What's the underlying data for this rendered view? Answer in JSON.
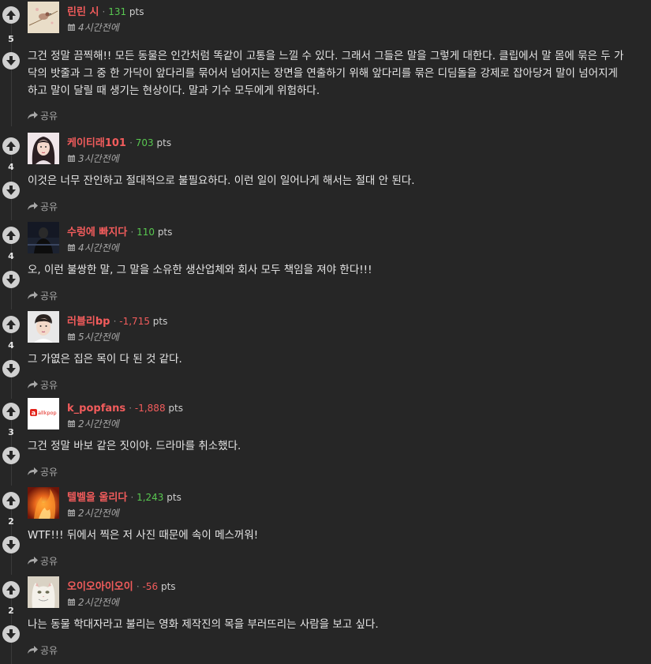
{
  "labels": {
    "share": "공유"
  },
  "comments": [
    {
      "score": "5",
      "author": "린린 시",
      "points": "131",
      "points_label": "pts",
      "points_sign": "pos",
      "time": "4시간전에",
      "avatar": "bird-avatar",
      "text": "그건 정말 끔찍해!! 모든 동물은 인간처럼 똑같이 고통을 느낄 수 있다. 그래서 그들은 말을 그렇게 대한다. 클립에서 말 몸에 묶은 두 가닥의 밧줄과 그 중 한 가닥이 앞다리를 묶어서 넘어지는 장면을 연출하기 위해 앞다리를 묶은 디딤돌을 강제로 잡아당겨 말이 넘어지게 하고 말이 달릴 때 생기는 현상이다. 말과 기수 모두에게 위험하다."
    },
    {
      "score": "4",
      "author": "케이티래101",
      "points": "703",
      "points_label": "pts",
      "points_sign": "pos",
      "time": "3시간전에",
      "avatar": "woman-avatar",
      "text": "이것은 너무 잔인하고 절대적으로 불필요하다. 이런 일이 일어나게 해서는 절대 안 된다."
    },
    {
      "score": "4",
      "author": "수렁에 빠지다",
      "points": "110",
      "points_label": "pts",
      "points_sign": "pos",
      "time": "4시간전에",
      "avatar": "dark-figure-avatar",
      "text": "오, 이런 불쌍한 말, 그 말을 소유한 생산업체와 회사 모두 책임을 져야 한다!!!"
    },
    {
      "score": "4",
      "author": "러블리bp",
      "points": "-1,715",
      "points_label": "pts",
      "points_sign": "neg",
      "time": "5시간전에",
      "avatar": "man-avatar",
      "text": "그 가엾은 집은 목이 다 된 것 같다."
    },
    {
      "score": "3",
      "author": "k_popfans",
      "points": "-1,888",
      "points_label": "pts",
      "points_sign": "neg",
      "time": "2시간전에",
      "avatar": "allkpop-logo-avatar",
      "avatar_text": "allkpop",
      "text": "그건 정말 바보 같은 짓이야. 드라마를 취소했다."
    },
    {
      "score": "2",
      "author": "텔벨을 울리다",
      "points": "1,243",
      "points_label": "pts",
      "points_sign": "pos",
      "time": "2시간전에",
      "avatar": "fire-avatar",
      "text": "WTF!!! 뒤에서 찍은 저 사진 때문에 속이 메스꺼워!"
    },
    {
      "score": "2",
      "author": "오이오아이오이",
      "points": "-56",
      "points_label": "pts",
      "points_sign": "neg",
      "time": "2시간전에",
      "avatar": "cat-avatar",
      "text": "나는 동물 학대자라고 불리는 영화 제작진의 목을 부러뜨리는 사람을 보고 싶다."
    }
  ]
}
